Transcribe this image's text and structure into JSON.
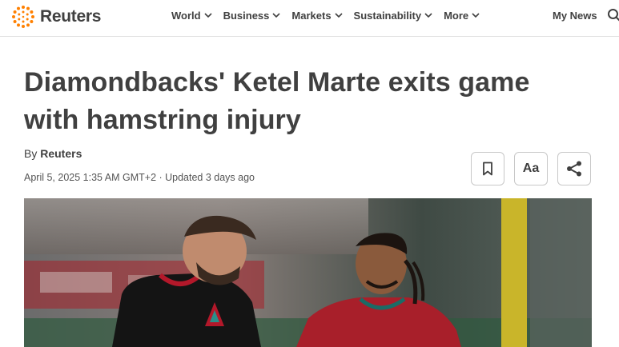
{
  "brand": {
    "name": "Reuters",
    "accent": "#ff8000"
  },
  "nav": {
    "items": [
      {
        "label": "World"
      },
      {
        "label": "Business"
      },
      {
        "label": "Markets"
      },
      {
        "label": "Sustainability"
      },
      {
        "label": "More"
      }
    ],
    "my_news": "My News"
  },
  "article": {
    "headline_line1": "Diamondbacks' Ketel Marte exits game",
    "headline_line2": "with hamstring injury",
    "byline_prefix": "By ",
    "byline_author": "Reuters",
    "dateline": "April 5, 2025 1:35 AM GMT+2 · Updated 3 days ago",
    "text_size_label": "Aa",
    "icons": [
      "bookmark-icon",
      "share-icon",
      "search-icon"
    ]
  }
}
